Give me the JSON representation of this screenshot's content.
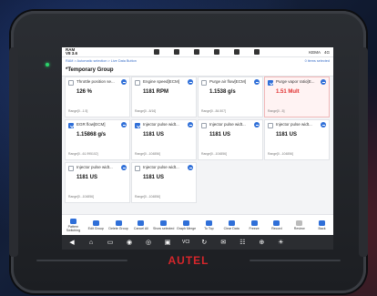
{
  "status": {
    "brand": "RAM",
    "model": "V8 3.6",
    "battery": "KEMA",
    "clock": "4G"
  },
  "breadcrumb": "RAM > Automatic selection > Live Data Button",
  "pager": "0 items selected",
  "group_title": "*Temporary Group",
  "cards": [
    {
      "name": "Throttle position se...",
      "value": "126 %",
      "range": "Range[0...1.5]",
      "checked": false,
      "highlight": false
    },
    {
      "name": "Engine speed[ECM]",
      "value": "1181 RPM",
      "range": "Range[0...8/16]",
      "checked": false,
      "highlight": false
    },
    {
      "name": "Purge air flow[ECM]",
      "value": "1.1538 g/s",
      "range": "Range[0...84.507]",
      "checked": false,
      "highlight": false
    },
    {
      "name": "Purge vapor ratio[E...",
      "value": "1.51 Mult",
      "range": "Range[0...5]",
      "checked": true,
      "highlight": true
    },
    {
      "name": "EGR flow[ECM]",
      "value": "1.15868 g/s",
      "range": "Range[0...61.995102]",
      "checked": true,
      "highlight": false
    },
    {
      "name": "Injector pulse widt...",
      "value": "1181 US",
      "range": "Range[0...104856]",
      "checked": true,
      "highlight": false
    },
    {
      "name": "Injector pulse widt...",
      "value": "1181 US",
      "range": "Range[0...104856]",
      "checked": false,
      "highlight": false
    },
    {
      "name": "Injector pulse widt...",
      "value": "1181 US",
      "range": "Range[0...104856]",
      "checked": false,
      "highlight": false
    },
    {
      "name": "Injector pulse widt...",
      "value": "1181 US",
      "range": "Range[0...104856]",
      "checked": false,
      "highlight": false
    },
    {
      "name": "Injector pulse widt...",
      "value": "1181 US",
      "range": "Range[0...104856]",
      "checked": false,
      "highlight": false
    }
  ],
  "tools": [
    {
      "label": "Pattern Switching",
      "icon": "switch-icon"
    },
    {
      "label": "Edit Group",
      "icon": "edit-icon"
    },
    {
      "label": "Delete Group",
      "icon": "delete-group-icon"
    },
    {
      "label": "Cancel All",
      "icon": "cancel-icon"
    },
    {
      "label": "Show selected",
      "icon": "show-selected-icon"
    },
    {
      "label": "Graph Merge",
      "icon": "graph-merge-icon"
    },
    {
      "label": "To Top",
      "icon": "to-top-icon"
    },
    {
      "label": "Clear Data",
      "icon": "clear-data-icon"
    },
    {
      "label": "Freeze",
      "icon": "freeze-icon"
    },
    {
      "label": "Record",
      "icon": "record-icon"
    },
    {
      "label": "Review",
      "icon": "review-icon"
    },
    {
      "label": "Back",
      "icon": "back-icon"
    }
  ],
  "nav": [
    "◀",
    "⌂",
    "▭",
    "◉",
    "◎",
    "▣",
    "VCI",
    "↻",
    "✉",
    "☷",
    "⊕",
    "☀"
  ],
  "logo": "AUTEL"
}
